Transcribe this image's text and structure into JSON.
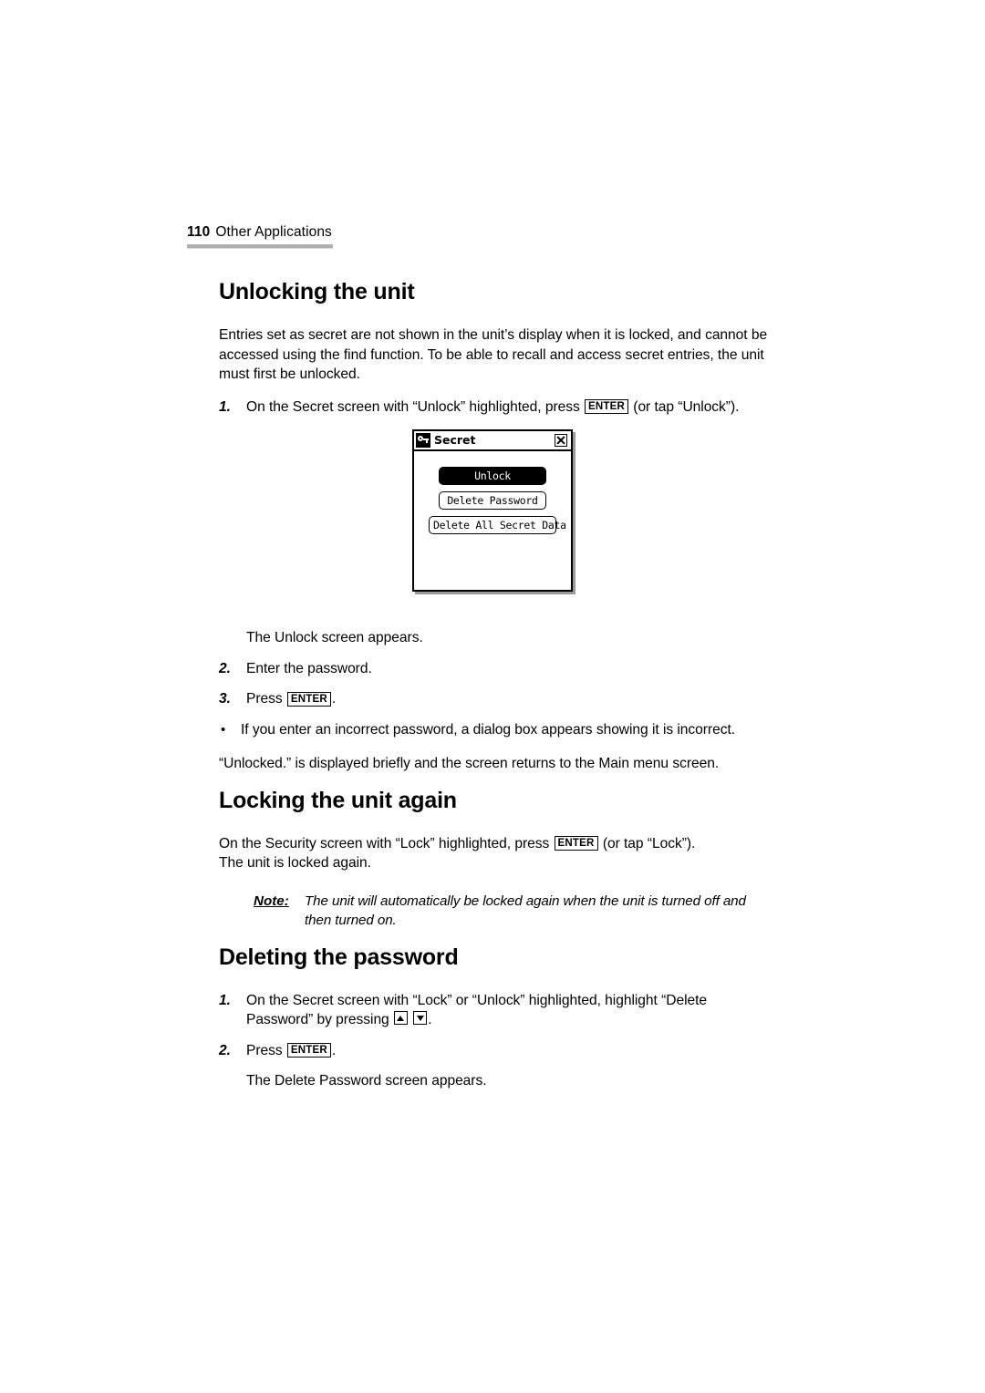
{
  "runhead": {
    "folio": "110",
    "title": "Other Applications"
  },
  "sections": {
    "unlocking": {
      "heading": "Unlocking the unit",
      "intro": "Entries set as secret are not shown in the unit’s display when it is locked, and cannot be accessed using the find function. To be able to recall and access secret entries, the unit must first be unlocked.",
      "step1_num": "1.",
      "step1_a": "On the Secret screen with “Unlock” highlighted, press",
      "step1_b": "(or tap “Unlock”).",
      "after_figure": "The Unlock screen appears.",
      "step2_num": "2.",
      "step2_text": "Enter the password.",
      "step3_num": "3.",
      "step3_a": "Press",
      "step3_b": ".",
      "bullet_mark": "•",
      "bullet_text": "If you enter an incorrect password, a dialog box appears showing it is incorrect.",
      "closing": "“Unlocked.” is displayed briefly and the screen returns to the Main menu screen."
    },
    "locking": {
      "heading": "Locking the unit again",
      "para_a": "On the Security screen with “Lock” highlighted, press",
      "para_b": "(or tap “Lock”).",
      "para_c": "The unit is locked again.",
      "note_label": "Note:",
      "note_body": "The unit will automatically be locked again when the unit is turned off and then turned on."
    },
    "deleting": {
      "heading": "Deleting the password",
      "step1_num": "1.",
      "step1_a": "On the Secret screen with “Lock” or “Unlock” highlighted, highlight “Delete Password” by pressing",
      "step1_b": ".",
      "step2_num": "2.",
      "step2_a": "Press",
      "step2_b": ".",
      "after": "The Delete Password screen appears."
    }
  },
  "keys": {
    "enter": "ENTER",
    "up": "up-arrow",
    "down": "down-arrow"
  },
  "device": {
    "title": "Secret",
    "icon": "key-icon",
    "close": "close-icon",
    "buttons": [
      {
        "label": "Unlock",
        "state": "highlighted"
      },
      {
        "label": "Delete Password",
        "state": "normal"
      },
      {
        "label": "Delete All Secret Data",
        "state": "normal"
      }
    ]
  },
  "colors": {
    "page_bg": "#ffffff",
    "text": "#000000",
    "rule": "#b0b0b0",
    "device_shadow": "#9a9a9a"
  }
}
